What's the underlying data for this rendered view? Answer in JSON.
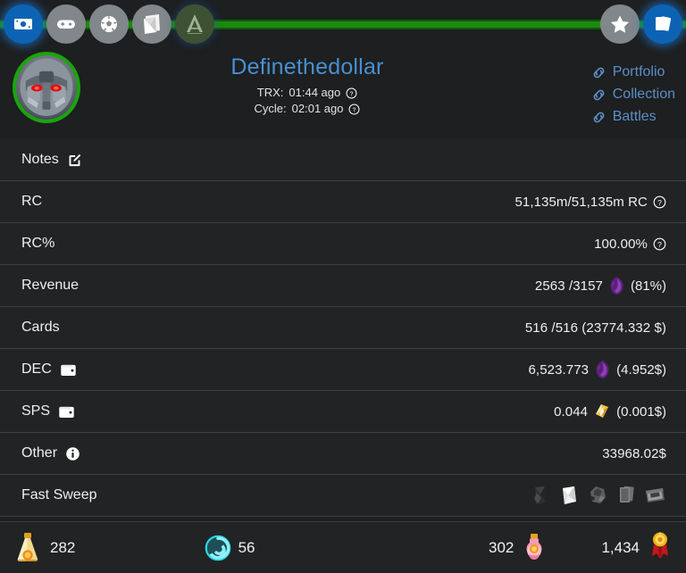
{
  "theme": {
    "bg": "#1d1f20",
    "row_bg": "#212324",
    "divider": "#3c4143",
    "accent_blue": "#4a8fd1",
    "link_blue": "#5b8fc9",
    "rail_green": "#1d8a10",
    "avatar_ring": "#1aa50c"
  },
  "topnav": {
    "left_items": [
      {
        "name": "money-icon",
        "active": true
      },
      {
        "name": "gamepad-icon",
        "active": false
      },
      {
        "name": "soccer-ball-icon",
        "active": false
      },
      {
        "name": "card-pack-icon",
        "active": false
      },
      {
        "name": "letter-a-icon",
        "active": false
      }
    ],
    "right_items": [
      {
        "name": "star-icon",
        "active": false
      },
      {
        "name": "cards-icon",
        "active": true
      }
    ]
  },
  "header": {
    "username": "Definethedollar",
    "avatar_alt": "mech-avatar",
    "trx_label": "TRX:",
    "trx_value": "01:44 ago",
    "cycle_label": "Cycle:",
    "cycle_value": "02:01 ago",
    "links": [
      {
        "label": "Portfolio",
        "icon": "link-icon"
      },
      {
        "label": "Collection",
        "icon": "link-icon"
      },
      {
        "label": "Battles",
        "icon": "link-icon"
      }
    ]
  },
  "rows": [
    {
      "key": "notes",
      "label": "Notes",
      "label_icon": "edit-icon",
      "value": "",
      "value_icon": "",
      "help": false
    },
    {
      "key": "rc",
      "label": "RC",
      "label_icon": "",
      "value": "51,135m/51,135m RC",
      "value_icon": "",
      "help": true
    },
    {
      "key": "rc_percent",
      "label": "RC%",
      "label_icon": "",
      "value": "100.00%",
      "value_icon": "",
      "help": true
    },
    {
      "key": "revenue",
      "label": "Revenue",
      "label_icon": "",
      "value": "2563 /3157",
      "value_icon": "dec-icon",
      "value_suffix": "(81%)",
      "help": false
    },
    {
      "key": "cards",
      "label": "Cards",
      "label_icon": "",
      "value": "516 /516 (23774.332 $)",
      "value_icon": "",
      "help": false
    },
    {
      "key": "dec",
      "label": "DEC",
      "label_icon": "wallet-icon",
      "value": "6,523.773",
      "value_icon": "dec-icon",
      "value_suffix": "(4.952$)",
      "help": false
    },
    {
      "key": "sps",
      "label": "SPS",
      "label_icon": "wallet-icon",
      "value": "0.044",
      "value_icon": "sps-icon",
      "value_suffix": "(0.001$)",
      "help": false
    },
    {
      "key": "other",
      "label": "Other",
      "label_icon": "info-icon",
      "value": "33968.02$",
      "value_icon": "",
      "help": false
    },
    {
      "key": "fast_sweep",
      "label": "Fast Sweep",
      "label_icon": "",
      "value": "",
      "value_icon": "",
      "help": false
    }
  ],
  "fast_sweep": {
    "pack_icons": [
      "pack-dark-icon",
      "pack-white-icon",
      "pack-rock-icon",
      "pack-grey-icon",
      "pack-chest-icon"
    ]
  },
  "bottom_stats": [
    {
      "name": "gold-potion",
      "icon": "gold-potion-icon",
      "value": "282",
      "order": "icon-first"
    },
    {
      "name": "teal-spiral",
      "icon": "teal-spiral-icon",
      "value": "56",
      "order": "icon-first"
    },
    {
      "name": "pink-potion",
      "icon": "pink-potion-icon",
      "value": "302",
      "order": "value-first"
    },
    {
      "name": "gold-medal",
      "icon": "gold-medal-icon",
      "value": "1,434",
      "order": "value-first"
    }
  ]
}
